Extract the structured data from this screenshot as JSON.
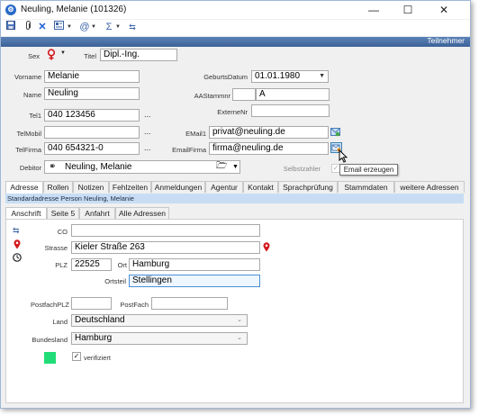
{
  "window": {
    "title": "Neuling, Melanie (101326)",
    "minimize": "—",
    "maximize": "☐",
    "close": "✕"
  },
  "header": {
    "label": "Teilnehmer"
  },
  "form": {
    "sex_label": "Sex",
    "titel_label": "Titel",
    "titel_value": "Dipl.-Ing.",
    "vorname_label": "Vorname",
    "vorname_value": "Melanie",
    "geburtsdatum_label": "GeburtsDatum",
    "geburtsdatum_value": "01.01.1980",
    "name_label": "Name",
    "name_value": "Neuling",
    "aastammnr_label": "AAStammnr",
    "aastammnr_value": "A",
    "externenr_label": "ExterneNr",
    "tel1_label": "Tel1",
    "tel1_value": "040 123456",
    "telmobil_label": "TelMobil",
    "email1_label": "EMail1",
    "email1_value": "privat@neuling.de",
    "telfirma_label": "TelFirma",
    "telfirma_value": "040 654321-0",
    "emailfirma_label": "EmailFirma",
    "emailfirma_value": "firma@neuling.de",
    "debitor_label": "Debitor",
    "debitor_value": "Neuling, Melanie",
    "selbstzahler_label": "Selbstzahler",
    "dots": "..."
  },
  "tooltip": {
    "text": "Email erzeugen"
  },
  "main_tabs": [
    "Adresse",
    "Rollen",
    "Notizen",
    "Fehlzeiten",
    "Anmeldungen",
    "Agentur",
    "Kontakt",
    "Sprachprüfung",
    "Stammdaten",
    "weitere Adressen"
  ],
  "info_strip": "Standardadresse Person Neuling, Melanie",
  "sub_tabs": [
    "Anschrift",
    "Seite 5",
    "Anfahrt",
    "Alle Adressen"
  ],
  "address": {
    "co_label": "CO",
    "co_value": "",
    "strasse_label": "Strasse",
    "strasse_value": "Kieler Straße 263",
    "plz_label": "PLZ",
    "plz_value": "22525",
    "ort_label": "Ort",
    "ort_value": "Hamburg",
    "ortsteil_label": "Ortsteil",
    "ortsteil_value": "Stellingen",
    "postfachplz_label": "PostfachPLZ",
    "postfach_label": "PostFach",
    "land_label": "Land",
    "land_value": "Deutschland",
    "bundesland_label": "Bundesland",
    "bundesland_value": "Hamburg",
    "verifiziert_label": "verifiziert",
    "status_color": "#22dd77"
  }
}
